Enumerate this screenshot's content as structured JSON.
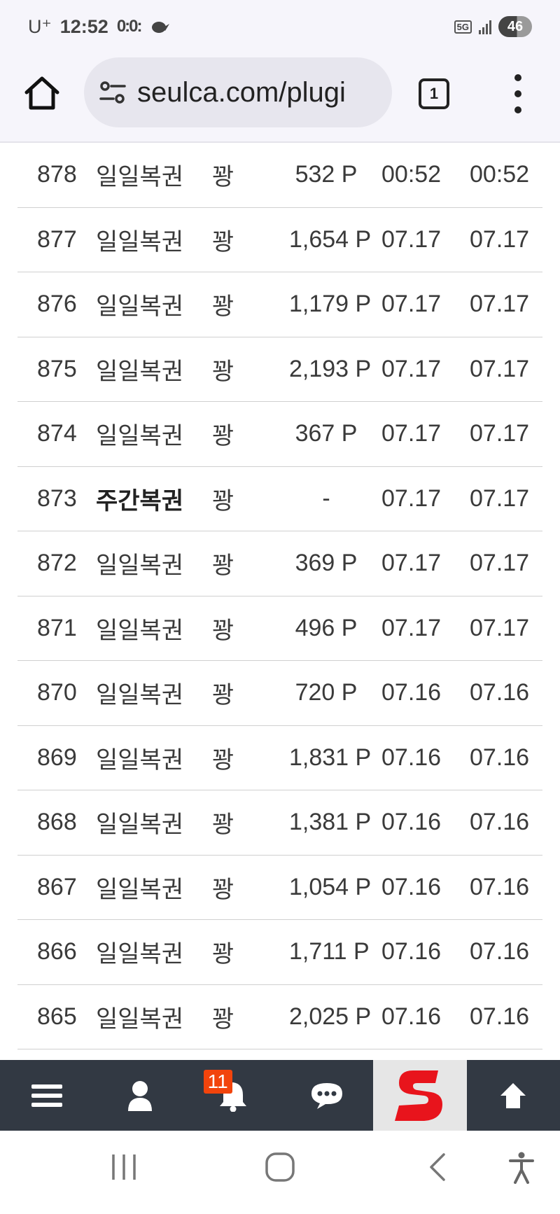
{
  "status_bar": {
    "carrier": "U⁺",
    "time": "12:52",
    "notification_icons": "0:0:",
    "network": "5G",
    "battery": "46"
  },
  "browser": {
    "url": "seulca.com/plugi",
    "tab_count": "1"
  },
  "table": {
    "rows": [
      {
        "num": "878",
        "name": "일일복권",
        "result": "꽝",
        "points": "532 P",
        "date1": "00:52",
        "date2": "00:52",
        "bold": false
      },
      {
        "num": "877",
        "name": "일일복권",
        "result": "꽝",
        "points": "1,654 P",
        "date1": "07.17",
        "date2": "07.17",
        "bold": false
      },
      {
        "num": "876",
        "name": "일일복권",
        "result": "꽝",
        "points": "1,179 P",
        "date1": "07.17",
        "date2": "07.17",
        "bold": false
      },
      {
        "num": "875",
        "name": "일일복권",
        "result": "꽝",
        "points": "2,193 P",
        "date1": "07.17",
        "date2": "07.17",
        "bold": false
      },
      {
        "num": "874",
        "name": "일일복권",
        "result": "꽝",
        "points": "367 P",
        "date1": "07.17",
        "date2": "07.17",
        "bold": false
      },
      {
        "num": "873",
        "name": "주간복권",
        "result": "꽝",
        "points": "-",
        "date1": "07.17",
        "date2": "07.17",
        "bold": true
      },
      {
        "num": "872",
        "name": "일일복권",
        "result": "꽝",
        "points": "369 P",
        "date1": "07.17",
        "date2": "07.17",
        "bold": false
      },
      {
        "num": "871",
        "name": "일일복권",
        "result": "꽝",
        "points": "496 P",
        "date1": "07.17",
        "date2": "07.17",
        "bold": false
      },
      {
        "num": "870",
        "name": "일일복권",
        "result": "꽝",
        "points": "720 P",
        "date1": "07.16",
        "date2": "07.16",
        "bold": false
      },
      {
        "num": "869",
        "name": "일일복권",
        "result": "꽝",
        "points": "1,831 P",
        "date1": "07.16",
        "date2": "07.16",
        "bold": false
      },
      {
        "num": "868",
        "name": "일일복권",
        "result": "꽝",
        "points": "1,381 P",
        "date1": "07.16",
        "date2": "07.16",
        "bold": false
      },
      {
        "num": "867",
        "name": "일일복권",
        "result": "꽝",
        "points": "1,054 P",
        "date1": "07.16",
        "date2": "07.16",
        "bold": false
      },
      {
        "num": "866",
        "name": "일일복권",
        "result": "꽝",
        "points": "1,711 P",
        "date1": "07.16",
        "date2": "07.16",
        "bold": false
      },
      {
        "num": "865",
        "name": "일일복권",
        "result": "꽝",
        "points": "2,025 P",
        "date1": "07.16",
        "date2": "07.16",
        "bold": false
      }
    ]
  },
  "site_nav": {
    "items": [
      {
        "icon": "hamburger-menu-icon"
      },
      {
        "icon": "user-icon"
      },
      {
        "icon": "bell-icon",
        "badge": "11"
      },
      {
        "icon": "chat-bubble-icon"
      },
      {
        "icon": "site-logo"
      },
      {
        "icon": "arrow-up-icon"
      }
    ],
    "colors": {
      "background": "#323943",
      "badge": "#f2440c",
      "logo_red": "#e8141c"
    }
  },
  "system_nav": {
    "buttons": [
      "recent-apps",
      "home",
      "back",
      "accessibility"
    ]
  }
}
